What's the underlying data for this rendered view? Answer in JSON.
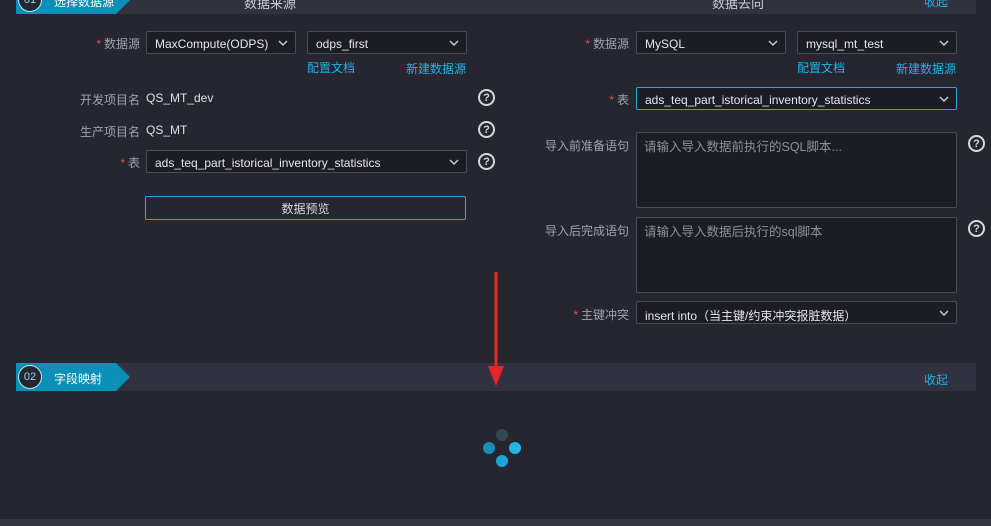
{
  "step1": {
    "number": "01",
    "title": "选择数据源",
    "source_heading": "数据来源",
    "target_heading": "数据去向",
    "collapse": "收起"
  },
  "source": {
    "datasource_label": "数据源",
    "datasource_type": "MaxCompute(ODPS)",
    "datasource_name": "odps_first",
    "config_doc": "配置文档",
    "new_datasource": "新建数据源",
    "dev_project_label": "开发项目名",
    "dev_project": "QS_MT_dev",
    "prod_project_label": "生产项目名",
    "prod_project": "QS_MT",
    "table_label": "表",
    "table": "ads_teq_part_istorical_inventory_statistics",
    "preview_button": "数据预览"
  },
  "target": {
    "datasource_label": "数据源",
    "datasource_type": "MySQL",
    "datasource_name": "mysql_mt_test",
    "config_doc": "配置文档",
    "new_datasource": "新建数据源",
    "table_label": "表",
    "table": "ads_teq_part_istorical_inventory_statistics",
    "pre_sql_label": "导入前准备语句",
    "pre_sql_placeholder": "请输入导入数据前执行的SQL脚本...",
    "post_sql_label": "导入后完成语句",
    "post_sql_placeholder": "请输入导入数据后执行的sql脚本",
    "conflict_label": "主键冲突",
    "conflict_value": "insert into（当主键/约束冲突报脏数据）"
  },
  "step2": {
    "number": "02",
    "title": "字段映射",
    "collapse": "收起"
  },
  "icons": {
    "help": "question-circle-icon",
    "dropdown": "chevron-down-icon",
    "loading": "loading-spinner-icon",
    "annotation": "red-arrow-annotation"
  },
  "colors": {
    "accent": "#0a8fb8",
    "link": "#22b3e8",
    "required": "#f04848",
    "annotation": "#e8262a"
  }
}
